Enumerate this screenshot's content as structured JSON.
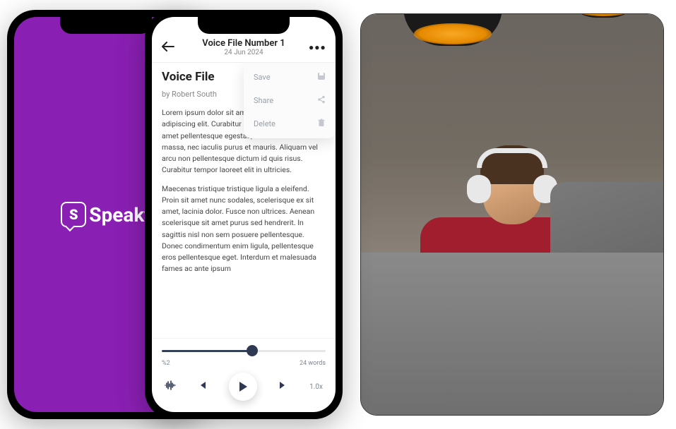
{
  "brand": {
    "name": "Speakt",
    "icon_letter": "S"
  },
  "header": {
    "title": "Voice File Number 1",
    "date": "24 Jun 2024"
  },
  "menu": {
    "save": "Save",
    "share": "Share",
    "delete": "Delete"
  },
  "document": {
    "title": "Voice  File ",
    "author": "by Robert South",
    "para1": "Lorem ipsum dolor sit amet, consectetur adipiscing elit. Curabitur accumsan, libero sit amet pellentesque egestas, nunc nisi hendrerit massa, nec iaculis purus et mauris. Aliquam vel arcu non pellentesque dictum id quis risus. Curabitur tempor laoreet elit in ultricies.",
    "para2": "Maecenas tristique tristique ligula a eleifend. Proin sit amet nunc sodales, scelerisque ex sit amet, lacinia dolor. Fusce non ultrices. Aenean scelerisque sit amet purus sed hendrerit. In sagittis nisl non sem posuere pellentesque. Donec condimentum enim ligula, pellentesque eros pellentesque eget. Interdum et malesuada fames ac ante ipsum"
  },
  "player": {
    "percent": "%2",
    "words": "24 words",
    "speed": "1.0x",
    "progress_percent": 55
  },
  "icons": {
    "save": "💾",
    "share": "📤",
    "delete": "🗑"
  }
}
